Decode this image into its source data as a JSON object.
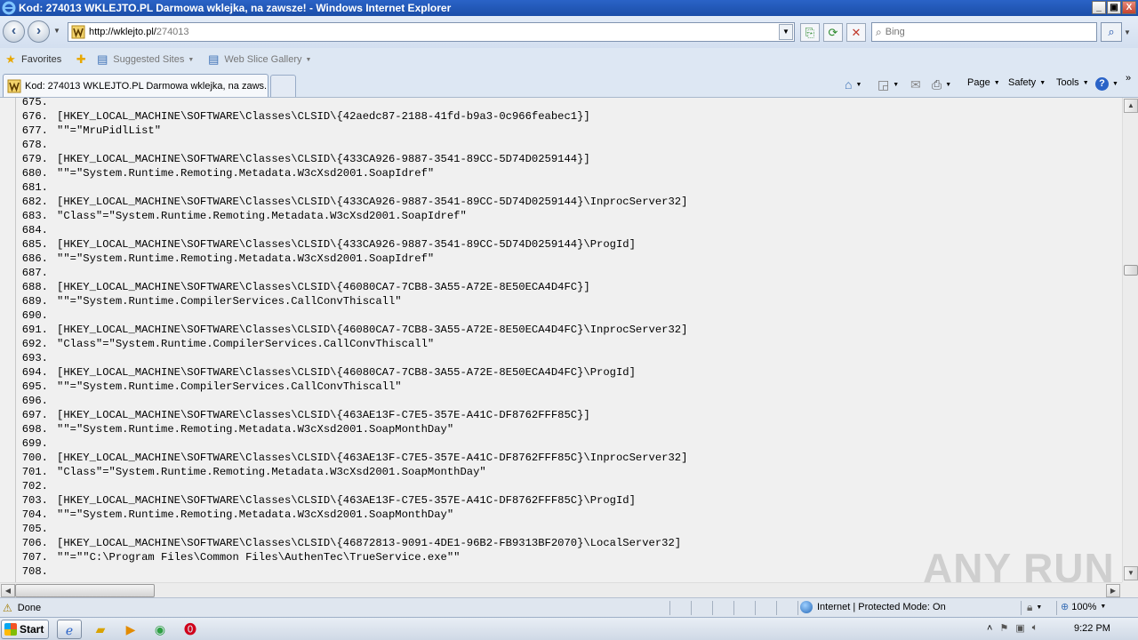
{
  "window": {
    "title": "Kod: 274013 WKLEJTO.PL Darmowa wklejka, na zawsze! - Windows Internet Explorer",
    "controls": [
      "_",
      "▣",
      "X"
    ]
  },
  "address_bar": {
    "url_host": "http://wklejto.pl/",
    "url_path": "274013"
  },
  "search": {
    "placeholder": "Bing"
  },
  "favorites_bar": {
    "favorites_label": "Favorites",
    "suggested_sites_label": "Suggested Sites",
    "web_slice_gallery_label": "Web Slice Gallery"
  },
  "tab": {
    "label": "Kod: 274013 WKLEJTO.PL Darmowa wklejka, na zaws..."
  },
  "command_bar": {
    "page_label": "Page",
    "safety_label": "Safety",
    "tools_label": "Tools"
  },
  "code_lines": [
    {
      "num": "675.",
      "text": ""
    },
    {
      "num": "676.",
      "text": "[HKEY_LOCAL_MACHINE\\SOFTWARE\\Classes\\CLSID\\{42aedc87-2188-41fd-b9a3-0c966feabec1}]"
    },
    {
      "num": "677.",
      "text": "\"\"=\"MruPidlList\""
    },
    {
      "num": "678.",
      "text": ""
    },
    {
      "num": "679.",
      "text": "[HKEY_LOCAL_MACHINE\\SOFTWARE\\Classes\\CLSID\\{433CA926-9887-3541-89CC-5D74D0259144}]"
    },
    {
      "num": "680.",
      "text": "\"\"=\"System.Runtime.Remoting.Metadata.W3cXsd2001.SoapIdref\""
    },
    {
      "num": "681.",
      "text": ""
    },
    {
      "num": "682.",
      "text": "[HKEY_LOCAL_MACHINE\\SOFTWARE\\Classes\\CLSID\\{433CA926-9887-3541-89CC-5D74D0259144}\\InprocServer32]"
    },
    {
      "num": "683.",
      "text": "\"Class\"=\"System.Runtime.Remoting.Metadata.W3cXsd2001.SoapIdref\""
    },
    {
      "num": "684.",
      "text": ""
    },
    {
      "num": "685.",
      "text": "[HKEY_LOCAL_MACHINE\\SOFTWARE\\Classes\\CLSID\\{433CA926-9887-3541-89CC-5D74D0259144}\\ProgId]"
    },
    {
      "num": "686.",
      "text": "\"\"=\"System.Runtime.Remoting.Metadata.W3cXsd2001.SoapIdref\""
    },
    {
      "num": "687.",
      "text": ""
    },
    {
      "num": "688.",
      "text": "[HKEY_LOCAL_MACHINE\\SOFTWARE\\Classes\\CLSID\\{46080CA7-7CB8-3A55-A72E-8E50ECA4D4FC}]"
    },
    {
      "num": "689.",
      "text": "\"\"=\"System.Runtime.CompilerServices.CallConvThiscall\""
    },
    {
      "num": "690.",
      "text": ""
    },
    {
      "num": "691.",
      "text": "[HKEY_LOCAL_MACHINE\\SOFTWARE\\Classes\\CLSID\\{46080CA7-7CB8-3A55-A72E-8E50ECA4D4FC}\\InprocServer32]"
    },
    {
      "num": "692.",
      "text": "\"Class\"=\"System.Runtime.CompilerServices.CallConvThiscall\""
    },
    {
      "num": "693.",
      "text": ""
    },
    {
      "num": "694.",
      "text": "[HKEY_LOCAL_MACHINE\\SOFTWARE\\Classes\\CLSID\\{46080CA7-7CB8-3A55-A72E-8E50ECA4D4FC}\\ProgId]"
    },
    {
      "num": "695.",
      "text": "\"\"=\"System.Runtime.CompilerServices.CallConvThiscall\""
    },
    {
      "num": "696.",
      "text": ""
    },
    {
      "num": "697.",
      "text": "[HKEY_LOCAL_MACHINE\\SOFTWARE\\Classes\\CLSID\\{463AE13F-C7E5-357E-A41C-DF8762FFF85C}]"
    },
    {
      "num": "698.",
      "text": "\"\"=\"System.Runtime.Remoting.Metadata.W3cXsd2001.SoapMonthDay\""
    },
    {
      "num": "699.",
      "text": ""
    },
    {
      "num": "700.",
      "text": "[HKEY_LOCAL_MACHINE\\SOFTWARE\\Classes\\CLSID\\{463AE13F-C7E5-357E-A41C-DF8762FFF85C}\\InprocServer32]"
    },
    {
      "num": "701.",
      "text": "\"Class\"=\"System.Runtime.Remoting.Metadata.W3cXsd2001.SoapMonthDay\""
    },
    {
      "num": "702.",
      "text": ""
    },
    {
      "num": "703.",
      "text": "[HKEY_LOCAL_MACHINE\\SOFTWARE\\Classes\\CLSID\\{463AE13F-C7E5-357E-A41C-DF8762FFF85C}\\ProgId]"
    },
    {
      "num": "704.",
      "text": "\"\"=\"System.Runtime.Remoting.Metadata.W3cXsd2001.SoapMonthDay\""
    },
    {
      "num": "705.",
      "text": ""
    },
    {
      "num": "706.",
      "text": "[HKEY_LOCAL_MACHINE\\SOFTWARE\\Classes\\CLSID\\{46872813-9091-4DE1-96B2-FB9313BF2070}\\LocalServer32]"
    },
    {
      "num": "707.",
      "text": "\"\"=\"\"C:\\Program Files\\Common Files\\AuthenTec\\TrueService.exe\"\""
    },
    {
      "num": "708.",
      "text": ""
    }
  ],
  "watermark": {
    "text": "ANY RUN"
  },
  "status_bar": {
    "status_text": "Done",
    "zone_text": "Internet | Protected Mode: On",
    "zoom_text": "100%"
  },
  "taskbar": {
    "start_label": "Start",
    "clock": "9:22 PM"
  },
  "colors": {
    "title_bar": "#1b4ea8",
    "content_background": "#f0f0f0",
    "chrome_background": "#dde7f3"
  }
}
